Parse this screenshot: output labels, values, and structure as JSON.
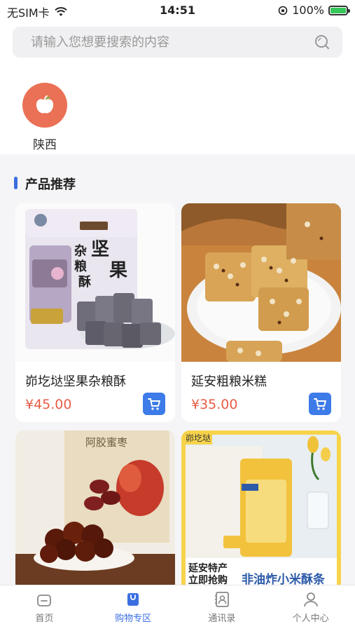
{
  "status": {
    "carrier": "无SIM卡",
    "time": "14:51",
    "battery": "100%",
    "battery_level": 1.0
  },
  "search": {
    "placeholder": "请输入您想要搜索的内容"
  },
  "categories": [
    {
      "label": "陕西",
      "icon": "apple-icon"
    }
  ],
  "section": {
    "title": "产品推荐"
  },
  "products": [
    {
      "name": "峁圪垯坚果杂粮酥",
      "price": "¥45.00",
      "package_title": "坚果杂粮酥"
    },
    {
      "name": "延安粗粮米糕",
      "price": "¥35.00"
    },
    {
      "name": "",
      "price": "",
      "package_title": "阿胶蜜枣"
    },
    {
      "name": "",
      "price": "",
      "brand": "峁圪垯",
      "promo_line1": "延安特产",
      "promo_line2": "立即抢购",
      "package_title": "非油炸小米酥条"
    }
  ],
  "tabs": [
    {
      "label": "首页",
      "icon": "home-icon",
      "active": false
    },
    {
      "label": "购物专区",
      "icon": "shopping-icon",
      "active": true
    },
    {
      "label": "通讯录",
      "icon": "contacts-icon",
      "active": false
    },
    {
      "label": "个人中心",
      "icon": "person-icon",
      "active": false
    }
  ],
  "colors": {
    "accent": "#3b6fe0",
    "price": "#e65d47",
    "category_bg": "#ea7155"
  }
}
